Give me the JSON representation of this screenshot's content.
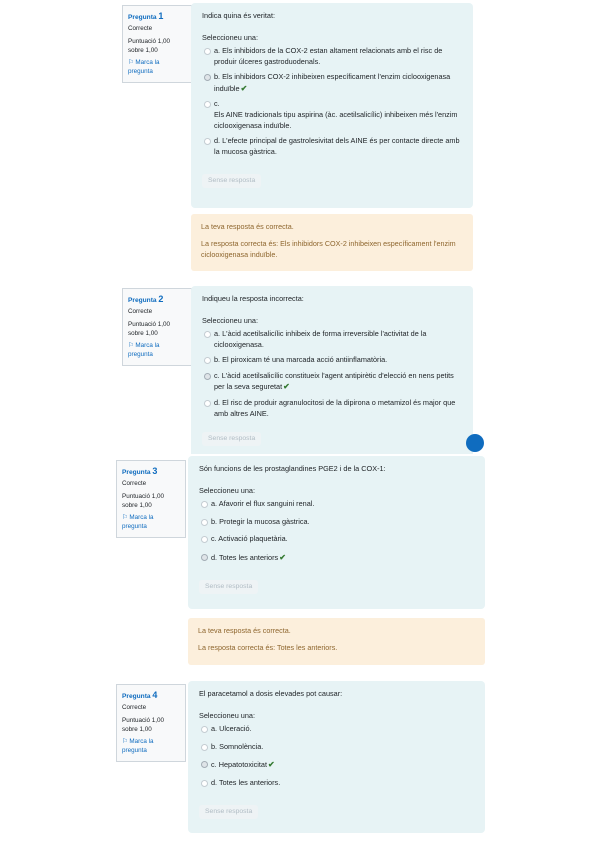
{
  "questions": [
    {
      "label": "Pregunta",
      "number": "1",
      "state": "Correcte",
      "grade": "Puntuació 1,00 sobre 1,00",
      "flag": "Marca la pregunta",
      "flag_icon": "flag-icon",
      "text": "Indica quina és veritat:",
      "prompt": "Seleccioneu una:",
      "options": [
        {
          "text": "a. Els inhibidors de la COX-2 estan altament relacionats amb el risc de produir úlceres gastroduodenals.",
          "selected": false
        },
        {
          "text": "b. Els inhibidors COX-2 inhibeixen específicament l'enzim ciclooxigenasa induïble",
          "selected": true,
          "correct": true
        },
        {
          "text": "c.\nEls AINE tradicionals tipu aspirina (àc. acetilsalicílic) inhibeixen més l'enzim ciclooxigenasa induïble.",
          "selected": false
        },
        {
          "text": "d. L'efecte principal de gastrolesivitat dels AINE és per contacte directe amb la mucosa gàstrica.",
          "selected": false
        }
      ],
      "clear": "Sense resposta",
      "feedback": {
        "general": "La teva resposta és correcta.",
        "right_answer": "La resposta correcta és: Els inhibidors COX-2 inhibeixen específicament l'enzim ciclooxigenasa induïble."
      }
    },
    {
      "label": "Pregunta",
      "number": "2",
      "state": "Correcte",
      "grade": "Puntuació 1,00 sobre 1,00",
      "flag": "Marca la pregunta",
      "flag_icon": "flag-icon",
      "text": "Indiqueu la resposta incorrecta:",
      "prompt": "Seleccioneu una:",
      "options": [
        {
          "text": "a. L'àcid acetilsalicílic inhibeix de forma irreversible l'activitat de la ciclooxigenasa.",
          "selected": false
        },
        {
          "text": "b. El piroxicam té una marcada acció antiinflamatòria.",
          "selected": false
        },
        {
          "text": "c. L'àcid acetilsalicílic constitueix l'agent antipirètic d'elecció en nens petits per la seva seguretat",
          "selected": true,
          "correct": true
        },
        {
          "text": "d. El risc de produir agranulocitosi de la dipirona o metamizol és major que amb altres AINE.",
          "selected": false
        }
      ],
      "clear": "Sense resposta"
    },
    {
      "label": "Pregunta",
      "number": "3",
      "state": "Correcte",
      "grade": "Puntuació 1,00 sobre 1,00",
      "flag": "Marca la pregunta",
      "flag_icon": "flag-icon",
      "text": "Són funcions de les prostaglandines PGE2 i de la COX-1:",
      "prompt": "Seleccioneu una:",
      "options": [
        {
          "text": "a. Afavorir el flux sanguini renal.",
          "selected": false
        },
        {
          "text": "b. Protegir la mucosa gàstrica.",
          "selected": false
        },
        {
          "text": "c. Activació plaquetària.",
          "selected": false
        },
        {
          "text": "d. Totes les anteriors",
          "selected": true,
          "correct": true
        }
      ],
      "clear": "Sense resposta",
      "feedback": {
        "general": "La teva resposta és correcta.",
        "right_answer": "La resposta correcta és: Totes les anteriors."
      }
    },
    {
      "label": "Pregunta",
      "number": "4",
      "state": "Correcte",
      "grade": "Puntuació 1,00 sobre 1,00",
      "flag": "Marca la pregunta",
      "flag_icon": "flag-icon",
      "text": "El paracetamol a dosis elevades pot causar:",
      "prompt": "Seleccioneu una:",
      "options": [
        {
          "text": "a. Ulceració.",
          "selected": false
        },
        {
          "text": "b. Somnolència.",
          "selected": false
        },
        {
          "text": "c. Hepatotoxicitat",
          "selected": true,
          "correct": true
        },
        {
          "text": "d. Totes les anteriors.",
          "selected": false
        }
      ],
      "clear": "Sense resposta"
    }
  ],
  "tick_glyph": "✔",
  "flag_glyph": "⚐",
  "colors": {
    "accent": "#0f6cbf",
    "formulation_bg": "#e7f3f5",
    "feedback_bg": "#fcefdc",
    "feedback_text": "#8e662e",
    "correct_tick": "#357a32"
  }
}
